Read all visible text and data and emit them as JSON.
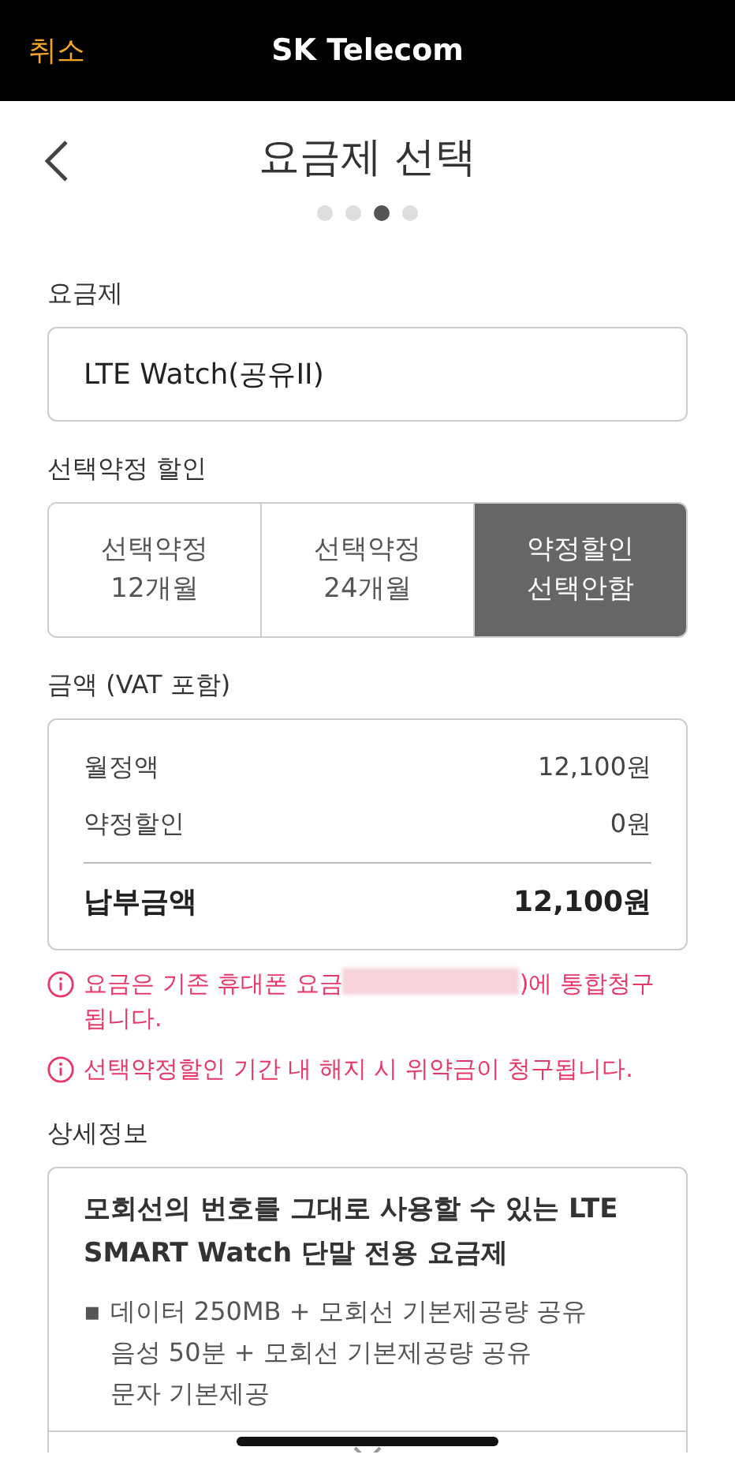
{
  "top_bar": {
    "cancel": "취소",
    "title": "SK Telecom"
  },
  "page": {
    "title": "요금제 선택",
    "steps": [
      {
        "selected": false
      },
      {
        "selected": false
      },
      {
        "selected": true
      },
      {
        "selected": false
      }
    ]
  },
  "plan": {
    "label": "요금제",
    "value": "LTE Watch(공유II)"
  },
  "discount": {
    "label": "선택약정 할인",
    "options": [
      {
        "lines": [
          "선택약정",
          "12개월"
        ],
        "selected": false
      },
      {
        "lines": [
          "선택약정",
          "24개월"
        ],
        "selected": false
      },
      {
        "lines": [
          "약정할인",
          "선택안함"
        ],
        "selected": true
      }
    ]
  },
  "amount": {
    "label": "금액 (VAT 포함)",
    "rows": [
      {
        "name": "월정액",
        "value": "12,100원"
      },
      {
        "name": "약정할인",
        "value": "0원"
      }
    ],
    "total": {
      "name": "납부금액",
      "value": "12,100원"
    }
  },
  "notices": [
    {
      "before": "요금은 기존 휴대폰 요금",
      "redacted": true,
      "after": ")에 통합청구 됩니다."
    },
    {
      "before": "선택약정할인 기간 내 해지 시 위약금이 청구됩니다.",
      "redacted": false
    }
  ],
  "details": {
    "label": "상세정보",
    "heading": "모회선의 번호를 그대로 사용할 수 있는 LTE SMART Watch 단말 전용 요금제",
    "items": [
      {
        "bullet": "▪",
        "lines": [
          "데이터 250MB + 모회선 기본제공량 공유",
          "음성 50분 + 모회선 기본제공량 공유",
          "문자 기본제공"
        ]
      }
    ]
  }
}
